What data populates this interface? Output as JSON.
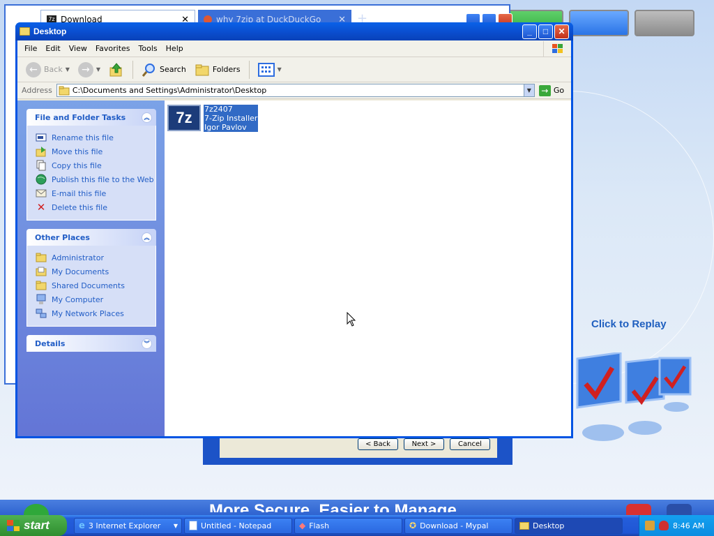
{
  "background": {
    "browser": {
      "tab1_label": "Download",
      "tab2_label": "why 7zip at DuckDuckGo",
      "new_tab_symbol": "+"
    },
    "installer_buttons": [
      "< Back",
      "Next >",
      "Cancel"
    ],
    "replay_text": "Click to Replay",
    "banner_text": "More Secure, Easier to Manage"
  },
  "window": {
    "title": "Desktop",
    "menu": [
      "File",
      "Edit",
      "View",
      "Favorites",
      "Tools",
      "Help"
    ],
    "toolbar": {
      "back": "Back",
      "search": "Search",
      "folders": "Folders"
    },
    "address": {
      "label": "Address",
      "value": "C:\\Documents and Settings\\Administrator\\Desktop",
      "go": "Go"
    },
    "file_tasks": {
      "title": "File and Folder Tasks",
      "items": [
        "Rename this file",
        "Move this file",
        "Copy this file",
        "Publish this file to the Web",
        "E-mail this file",
        "Delete this file"
      ]
    },
    "other_places": {
      "title": "Other Places",
      "items": [
        "Administrator",
        "My Documents",
        "Shared Documents",
        "My Computer",
        "My Network Places"
      ]
    },
    "details": {
      "title": "Details"
    },
    "file": {
      "icon_text": "7z",
      "name": "7z2407",
      "description": "7-Zip Installer",
      "company": "Igor Pavlov"
    }
  },
  "taskbar": {
    "start": "start",
    "tasks": [
      "3 Internet Explorer",
      "Untitled - Notepad",
      "Flash",
      "Download - Mypal",
      "Desktop"
    ],
    "clock": "8:46 AM"
  },
  "icons": {
    "folder": "folder-icon",
    "back": "back-arrow-icon",
    "forward": "forward-arrow-icon",
    "up": "up-folder-icon",
    "search": "search-icon",
    "views": "views-icon"
  },
  "colors": {
    "xp_blue": "#0054e3",
    "link_blue": "#215dc6",
    "selection": "#316ac5",
    "start_green": "#3c9b3c"
  }
}
